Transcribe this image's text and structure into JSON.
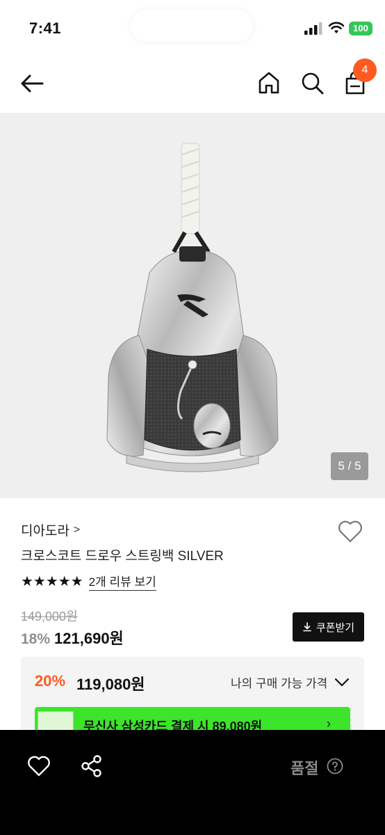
{
  "status_bar": {
    "time": "7:41",
    "battery": "100"
  },
  "nav": {
    "back_icon": "arrow-left-icon",
    "home_icon": "home-icon",
    "search_icon": "search-icon",
    "cart_icon": "shopping-bag-icon",
    "cart_count": "4"
  },
  "gallery": {
    "counter": "5 / 5",
    "brand_mark": "diadora"
  },
  "product": {
    "brand": "디아도라",
    "brand_chevron": ">",
    "name": "크로스코트 드로우 스트링백 SILVER",
    "rating_stars": "★★★★★",
    "review_link": "2개 리뷰 보기",
    "original_price": "149,000원",
    "sale_rate": "18%",
    "sale_price": "121,690원",
    "coupon_button": "쿠폰받기"
  },
  "best_price": {
    "rate": "20%",
    "price": "119,080원",
    "toggle_label": "나의 구매 가능 가격",
    "card_banner_text": "무신사 삼성카드 결제 시 89,080원"
  },
  "bottom_bar": {
    "status": "품절"
  },
  "colors": {
    "accent_orange": "#ff5a1f",
    "battery_green": "#34c759",
    "banner_green": "#3ce52a",
    "bottom_bar_bg": "#000000"
  }
}
